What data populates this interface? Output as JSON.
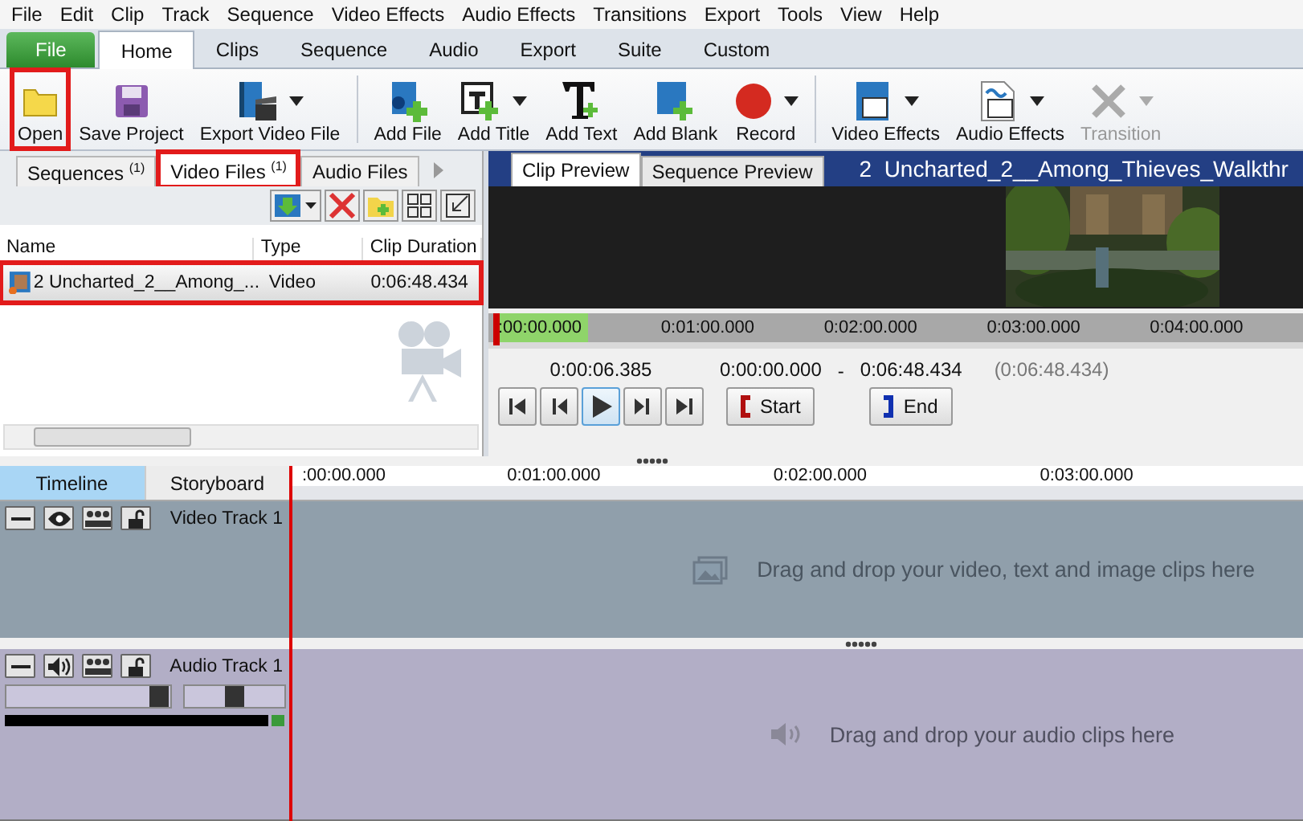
{
  "menu": [
    "File",
    "Edit",
    "Clip",
    "Track",
    "Sequence",
    "Video Effects",
    "Audio Effects",
    "Transitions",
    "Export",
    "Tools",
    "View",
    "Help"
  ],
  "ribbon_tabs": [
    {
      "label": "File",
      "kind": "file"
    },
    {
      "label": "Home",
      "kind": "tab",
      "selected": true
    },
    {
      "label": "Clips",
      "kind": "tab",
      "selected": false
    },
    {
      "label": "Sequence",
      "kind": "tab",
      "selected": false
    },
    {
      "label": "Audio",
      "kind": "tab",
      "selected": false
    },
    {
      "label": "Export",
      "kind": "tab",
      "selected": false
    },
    {
      "label": "Suite",
      "kind": "tab",
      "selected": false
    },
    {
      "label": "Custom",
      "kind": "tab",
      "selected": false
    }
  ],
  "toolbar": {
    "groups": [
      [
        {
          "label": "Open",
          "dropdown": false,
          "disabled": false,
          "highlighted": true
        },
        {
          "label": "Save Project",
          "dropdown": false,
          "disabled": false,
          "highlighted": false
        },
        {
          "label": "Export Video File",
          "dropdown": true,
          "disabled": false,
          "highlighted": false
        }
      ],
      [
        {
          "label": "Add File",
          "dropdown": false,
          "disabled": false,
          "highlighted": false
        },
        {
          "label": "Add Title",
          "dropdown": true,
          "disabled": false,
          "highlighted": false
        },
        {
          "label": "Add Text",
          "dropdown": false,
          "disabled": false,
          "highlighted": false
        },
        {
          "label": "Add Blank",
          "dropdown": false,
          "disabled": false,
          "highlighted": false
        },
        {
          "label": "Record",
          "dropdown": true,
          "disabled": false,
          "highlighted": false
        }
      ],
      [
        {
          "label": "Video Effects",
          "dropdown": true,
          "disabled": false,
          "highlighted": false
        },
        {
          "label": "Audio Effects",
          "dropdown": true,
          "disabled": false,
          "highlighted": false
        },
        {
          "label": "Transition",
          "dropdown": true,
          "disabled": true,
          "highlighted": false
        }
      ]
    ]
  },
  "media_panel": {
    "tabs": [
      {
        "label": "Sequences $^{(1)}$",
        "selected": false,
        "highlighted": false
      },
      {
        "label": "Video Files $^{(1)}$",
        "selected": true,
        "highlighted": true
      },
      {
        "label": "Audio Files",
        "selected": false,
        "highlighted": false
      }
    ],
    "columns": [
      "Name",
      "Type",
      "Clip Duration"
    ],
    "rows": [
      {
        "name": "2 Uncharted_2__Among_...",
        "type": "Video",
        "duration": "0:06:48.434",
        "selected": true,
        "highlighted": true
      }
    ]
  },
  "preview": {
    "tabs": [
      {
        "label": "Clip Preview",
        "selected": true
      },
      {
        "label": "Sequence Preview",
        "selected": false
      }
    ],
    "title": "2  Uncharted_2__Among_Thieves_Walkthr",
    "ruler": [
      ":00:00.000",
      "0:01:00.000",
      "0:02:00.000",
      "0:03:00.000",
      "0:04:00.000"
    ],
    "current_time": "0:00:06.385",
    "in_time": "0:00:00.000",
    "separator": "-",
    "out_time": "0:06:48.434",
    "duration": "(0:06:48.434)",
    "start_label": "Start",
    "end_label": "End"
  },
  "timeline": {
    "tabs": [
      {
        "label": "Timeline",
        "selected": true
      },
      {
        "label": "Storyboard",
        "selected": false
      }
    ],
    "ruler": [
      ":00:00.000",
      "0:01:00.000",
      "0:02:00.000",
      "0:03:00.000"
    ],
    "video_track": {
      "name": "Video Track 1",
      "hint": "Drag and drop your video, text and image clips here"
    },
    "audio_track": {
      "name": "Audio Track 1",
      "hint": "Drag and drop your audio clips here",
      "volume": {
        "level": 0.93
      },
      "pan": {
        "level": 0.5
      }
    }
  }
}
